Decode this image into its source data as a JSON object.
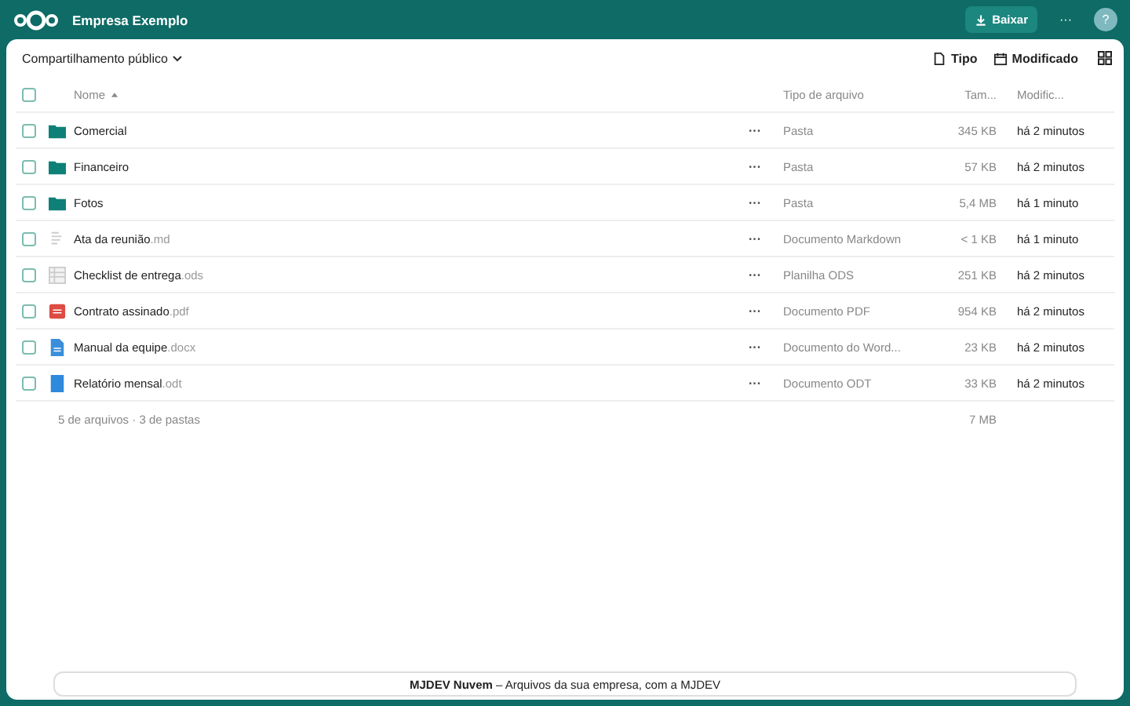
{
  "header": {
    "title": "Empresa Exemplo",
    "download_button": "Baixar",
    "more_button": "···",
    "help_button": "?"
  },
  "toolbar": {
    "share_menu": "Compartilhamento público",
    "filters": [
      {
        "label": "Tipo",
        "kind": "file"
      },
      {
        "label": "Modificado",
        "kind": "calendar"
      }
    ]
  },
  "table": {
    "all_checked": false,
    "columns": [
      "Nome",
      "Tipo de arquivo",
      "Tam...",
      "Modific..."
    ],
    "rows": [
      {
        "checked": false,
        "name": "Comercial",
        "ext": "",
        "kind": "folder",
        "actions": "···",
        "type": "Pasta",
        "size": "345 KB",
        "modified": "há 2 minutos"
      },
      {
        "checked": false,
        "name": "Financeiro",
        "ext": "",
        "kind": "folder",
        "actions": "···",
        "type": "Pasta",
        "size": "57 KB",
        "modified": "há 2 minutos"
      },
      {
        "checked": false,
        "name": "Fotos",
        "ext": "",
        "kind": "folder",
        "actions": "···",
        "type": "Pasta",
        "size": "5,4 MB",
        "modified": "há 1 minuto"
      },
      {
        "checked": false,
        "name": "Ata da reunião",
        "ext": ".md",
        "kind": "text",
        "actions": "···",
        "type": "Documento Markdown",
        "size": "< 1 KB",
        "modified": "há 1 minuto"
      },
      {
        "checked": false,
        "name": "Checklist de entrega",
        "ext": ".ods",
        "kind": "sheet",
        "actions": "···",
        "type": "Planilha ODS",
        "size": "251 KB",
        "modified": "há 2 minutos"
      },
      {
        "checked": false,
        "name": "Contrato assinado",
        "ext": ".pdf",
        "kind": "pdf",
        "actions": "···",
        "type": "Documento PDF",
        "size": "954 KB",
        "modified": "há 2 minutos"
      },
      {
        "checked": false,
        "name": "Manual da equipe",
        "ext": ".docx",
        "kind": "doc",
        "actions": "···",
        "type": "Documento do Word...",
        "size": "23 KB",
        "modified": "há 2 minutos"
      },
      {
        "checked": false,
        "name": "Relatório mensal",
        "ext": ".odt",
        "kind": "odt",
        "actions": "···",
        "type": "Documento ODT",
        "size": "33 KB",
        "modified": "há 2 minutos"
      }
    ],
    "summary": "5 de arquivos · 3 de pastas",
    "total_size": "7 MB"
  },
  "footer": "**MJDEV Nuvem** – Arquivos da sua empresa, com a MJDEV"
}
